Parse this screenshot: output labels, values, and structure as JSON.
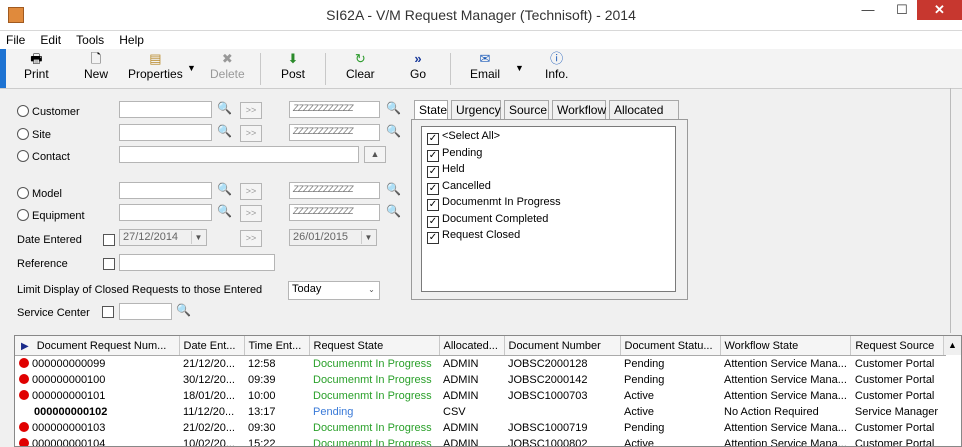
{
  "window": {
    "title": "SI62A - V/M Request Manager (Technisoft) - 2014"
  },
  "menu": [
    "File",
    "Edit",
    "Tools",
    "Help"
  ],
  "toolbar": {
    "print": "Print",
    "new": "New",
    "properties": "Properties",
    "delete": "Delete",
    "post": "Post",
    "clear": "Clear",
    "go": "Go",
    "email": "Email",
    "info": "Info."
  },
  "form": {
    "customer": "Customer",
    "site": "Site",
    "contact": "Contact",
    "model": "Model",
    "equipment": "Equipment",
    "date_entered": "Date Entered",
    "reference": "Reference",
    "limit_label": "Limit Display of Closed Requests to those Entered",
    "limit_value": "Today",
    "service_center": "Service Center",
    "date_from": "27/12/2014",
    "date_to": "26/01/2015",
    "pattern": "ZZZZZZZZZZZZ",
    "go_btn": ">>"
  },
  "tabs": [
    "State",
    "Urgency",
    "Source",
    "Workflow",
    "Allocated To"
  ],
  "states": [
    "<Select All>",
    "Pending",
    "Held",
    "Cancelled",
    "Documenmt In Progress",
    "Document Completed",
    "Request Closed"
  ],
  "grid": {
    "columns": [
      "Document Request Num...",
      "Date Ent...",
      "Time Ent...",
      "Request State",
      "Allocated...",
      "Document Number",
      "Document Statu...",
      "Workflow State",
      "Request Source"
    ],
    "rows": [
      [
        "000000000099",
        "21/12/20...",
        "12:58",
        "Documenmt In Progress",
        "ADMIN",
        "JOBSC2000128",
        "Pending",
        "Attention Service Mana...",
        "Customer Portal"
      ],
      [
        "000000000100",
        "30/12/20...",
        "09:39",
        "Documenmt In Progress",
        "ADMIN",
        "JOBSC2000142",
        "Pending",
        "Attention Service Mana...",
        "Customer Portal"
      ],
      [
        "000000000101",
        "18/01/20...",
        "10:00",
        "Documenmt In Progress",
        "ADMIN",
        "JOBSC1000703",
        "Active",
        "Attention Service Mana...",
        "Customer Portal"
      ],
      [
        "000000000102",
        "11/12/20...",
        "13:17",
        "Pending",
        "CSV",
        "",
        "Active",
        "No Action Required",
        "Service Manager"
      ],
      [
        "000000000103",
        "21/02/20...",
        "09:30",
        "Documenmt In Progress",
        "ADMIN",
        "JOBSC1000719",
        "Pending",
        "Attention Service Mana...",
        "Customer Portal"
      ],
      [
        "000000000104",
        "10/02/20...",
        "15:22",
        "Documenmt In Progress",
        "ADMIN",
        "JOBSC1000802",
        "Active",
        "Attention Service Mana...",
        "Customer Portal"
      ]
    ]
  }
}
